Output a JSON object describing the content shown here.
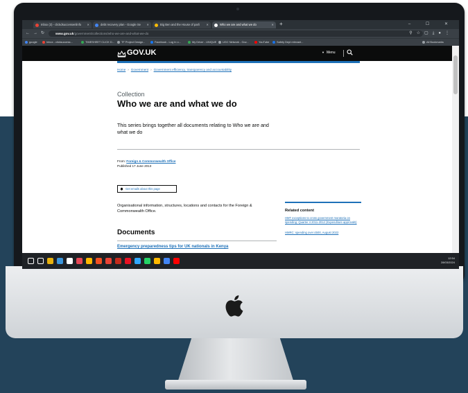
{
  "browser": {
    "tabs": [
      {
        "label": "Inbox (3) - clickdsuccessenlinfo",
        "fav_color": "#ea4335"
      },
      {
        "label": "debt recovery plan - Google Se",
        "fav_color": "#4285f4"
      },
      {
        "label": "Big Ben and the House of parli",
        "fav_color": "#fbbc05"
      },
      {
        "label": "Who we are and what we do",
        "fav_color": "#ffffff"
      }
    ],
    "new_tab": "+",
    "window_controls": "– ☐ ✕",
    "url_domain": "www.gov.uk",
    "url_path": "/government/collections/who-we-are-and-what-we-do",
    "bookmarks": [
      {
        "label": "google",
        "color": "#4285f4"
      },
      {
        "label": "Inbox - clicksuccess...",
        "color": "#ea4335"
      },
      {
        "label": "TIMESHEET CLICK D...",
        "color": "#34a853"
      },
      {
        "label": "TF Project Design...",
        "color": "#9aa0a6"
      },
      {
        "label": "Facebook - Log In o...",
        "color": "#1877f2"
      },
      {
        "label": "My Driver - UNIQUE",
        "color": "#34a853"
      },
      {
        "label": "UGC Network - Gov...",
        "color": "#9aa0a6"
      },
      {
        "label": "YouTube",
        "color": "#ff0000"
      },
      {
        "label": "Safety Dept relevant...",
        "color": "#1a73e8"
      },
      {
        "label": "All Bookmarks",
        "color": "#9aa0a6"
      }
    ]
  },
  "gov": {
    "logo": "GOV.UK",
    "menu": "Menu",
    "breadcrumbs": [
      "Home",
      "Government",
      "Government efficiency, transparency and accountability"
    ],
    "collection_label": "Collection",
    "title": "Who we are and what we do",
    "lead": "This series brings together all documents relating to Who we are and what we do",
    "from_label": "From:",
    "from_org": "Foreign & Commonwealth Office",
    "published": "Published 17 June 2013",
    "email_button": "Get emails about this page",
    "description": "Organisational information, structures, locations and contacts for the Foreign & Commonwealth Office.",
    "related_heading": "Related content",
    "related_links": [
      "HMT exceptions to cross government moratoria on spending: Quarter 4 2011-2012 (Expenditure approvals)",
      "HMRC: spending over £500, August 2022"
    ],
    "documents_heading": "Documents",
    "first_document": "Emergency preparedness tips for UK nationals in Kenya"
  },
  "taskbar": {
    "time": "12:54",
    "date": "28/03/2024",
    "icons": [
      "#ffffff",
      "#ffffff",
      "#e8b10d",
      "#3a96dd",
      "#ffffff",
      "#e74856",
      "#ffb900",
      "#f25022",
      "#ea4335",
      "#c42b1c",
      "#e81123",
      "#31a8ff",
      "#25d366",
      "#ffb900",
      "#4285f4",
      "#ff0000"
    ]
  }
}
